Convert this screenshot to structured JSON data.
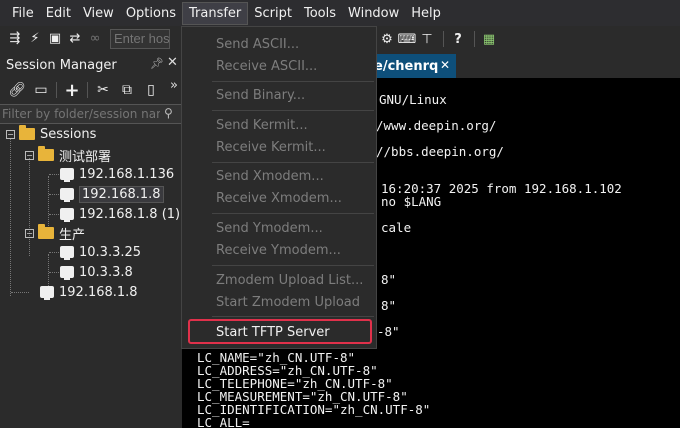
{
  "menubar": {
    "items": [
      "File",
      "Edit",
      "View",
      "Options",
      "Transfer",
      "Script",
      "Tools",
      "Window",
      "Help"
    ],
    "active": "Transfer"
  },
  "toolbar": {
    "host_placeholder": "Enter host",
    "left_icons": [
      "connect-icon",
      "quick-connect-icon",
      "terminal-icon",
      "reconnect-icon",
      "link-icon"
    ],
    "right_icons": [
      "gear-icon",
      "keyboard-icon",
      "keymap-icon",
      "help-icon",
      "sftp-icon"
    ]
  },
  "session_manager": {
    "title": "Session Manager",
    "filter_placeholder": "Filter by folder/session name",
    "tree": {
      "root": "Sessions",
      "folders": [
        {
          "name": "测试部署",
          "sessions": [
            "192.168.1.136",
            "192.168.1.8",
            "192.168.1.8 (1)"
          ]
        },
        {
          "name": "生产",
          "sessions": [
            "10.3.3.25",
            "10.3.3.8"
          ]
        }
      ],
      "root_sessions": [
        "192.168.1.8"
      ],
      "selected": "192.168.1.8"
    }
  },
  "tab": {
    "label": "e/chenrq",
    "color": "#0e4f7a"
  },
  "terminal": {
    "lines": [
      "GNU/Linux",
      "/www.deepin.org/",
      "//bbs.deepin.org/",
      "16:20:37 2025 from 192.168.1.102",
      "no $LANG",
      "cale",
      "8\"",
      "8\"",
      "-8\"",
      "LC_NAME=\"zh_CN.UTF-8\"",
      "LC_ADDRESS=\"zh_CN.UTF-8\"",
      "LC_TELEPHONE=\"zh_CN.UTF-8\"",
      "LC_MEASUREMENT=\"zh_CN.UTF-8\"",
      "LC_IDENTIFICATION=\"zh_CN.UTF-8\"",
      "LC_ALL="
    ]
  },
  "transfer_menu": {
    "items": [
      {
        "label": "Send ASCII...",
        "enabled": false
      },
      {
        "label": "Receive ASCII...",
        "enabled": false
      },
      {
        "label": "Send Binary...",
        "enabled": false
      },
      {
        "label": "Send Kermit...",
        "enabled": false
      },
      {
        "label": "Receive Kermit...",
        "enabled": false
      },
      {
        "label": "Send Xmodem...",
        "enabled": false
      },
      {
        "label": "Receive Xmodem...",
        "enabled": false
      },
      {
        "label": "Send Ymodem...",
        "enabled": false
      },
      {
        "label": "Receive Ymodem...",
        "enabled": false
      },
      {
        "label": "Zmodem Upload List...",
        "enabled": false
      },
      {
        "label": "Start Zmodem Upload",
        "enabled": false
      },
      {
        "label": "Start TFTP Server",
        "enabled": true
      }
    ],
    "highlighted": "Start TFTP Server",
    "highlight_color": "#e0314b"
  }
}
